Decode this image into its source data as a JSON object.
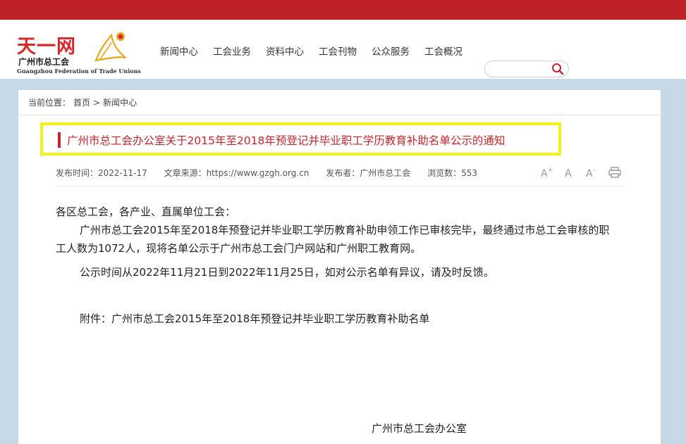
{
  "header": {
    "logo": {
      "title": "天一网",
      "subtitle": "广州市总工会",
      "english": "Guangzhou Federation of Trade Unions"
    },
    "nav": [
      "新闻中心",
      "工会业务",
      "资料中心",
      "工会刊物",
      "公众服务",
      "工会概况"
    ],
    "search": {
      "placeholder": "",
      "value": ""
    }
  },
  "breadcrumb": {
    "prefix": "当前位置：",
    "items": [
      "首页",
      "新闻中心"
    ],
    "separator": ">"
  },
  "article": {
    "title": "广州市总工会办公室关于2015年至2018年预登记并毕业职工学历教育补助名单公示的通知",
    "meta": {
      "date": "发布时间：2022-11-17",
      "source": "文章来源：https://www.gzgh.org.cn",
      "publisher": "发布者：广州市总工会",
      "views": "浏览数：553"
    },
    "salutation": "各区总工会，各产业、直属单位工会：",
    "paragraph1": "广州市总工会2015年至2018年预登记并毕业职工学历教育补助申领工作已审核完毕，最终通过市总工会审核的职工人数为1072人，现将名单公示于广州市总工会门户网站和广州职工教育网。",
    "paragraph2": "公示时间从2022年11月21日到2022年11月25日，如对公示名单有异议，请及时反馈。",
    "attachment": "附件：广州市总工会2015年至2018年预登记并毕业职工学历教育补助名单",
    "signature": "广州市总工会办公室"
  },
  "colors": {
    "brand_red": "#be2127",
    "title_red": "#c0262c",
    "highlight_yellow": "#f3f21a",
    "page_bg": "#c9d8e6"
  },
  "icons": [
    "search-icon",
    "font-larger-icon",
    "font-normal-icon",
    "font-smaller-icon",
    "print-icon",
    "logo-emblem-icon"
  ]
}
